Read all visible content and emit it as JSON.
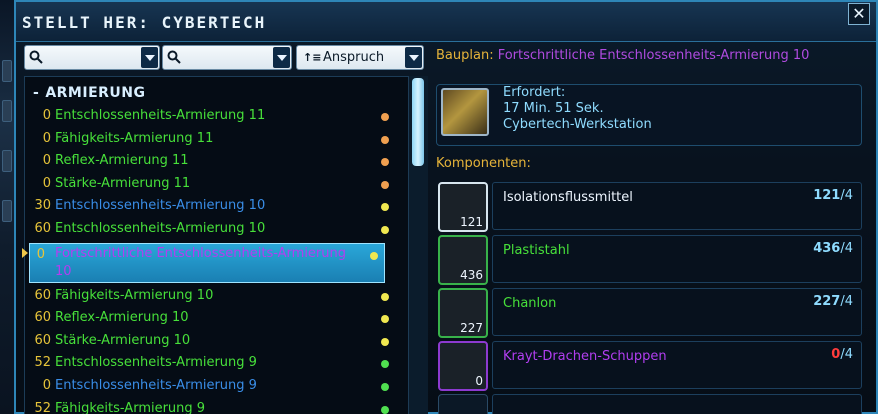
{
  "window": {
    "title": "STELLT HER: CYBERTECH",
    "close_label": "✕"
  },
  "filters": {
    "search1_placeholder": "",
    "search2_placeholder": "",
    "sort_label": "Anspruch",
    "sort_icon": "↑≡"
  },
  "list": {
    "category_label": "ARMIERUNG",
    "collapse_symbol": "-",
    "items": [
      {
        "level": "0",
        "name": "Entschlossenheits-Armierung 11",
        "name_color": "#47e03a",
        "dot_color": "#f0a050"
      },
      {
        "level": "0",
        "name": "Fähigkeits-Armierung 11",
        "name_color": "#47e03a",
        "dot_color": "#f0a050"
      },
      {
        "level": "0",
        "name": "Reflex-Armierung 11",
        "name_color": "#47e03a",
        "dot_color": "#f0a050"
      },
      {
        "level": "0",
        "name": "Stärke-Armierung 11",
        "name_color": "#47e03a",
        "dot_color": "#f0a050"
      },
      {
        "level": "30",
        "name": "Entschlossenheits-Armierung 10",
        "name_color": "#3a8ee8",
        "dot_color": "#f0e850"
      },
      {
        "level": "60",
        "name": "Entschlossenheits-Armierung 10",
        "name_color": "#47e03a",
        "dot_color": "#f0e850"
      },
      {
        "level": "0",
        "name": "Fortschrittliche Entschlossenheits-Armierung 10",
        "name_color": "#b23ef0",
        "dot_color": "#f0e850",
        "selected": true
      },
      {
        "level": "60",
        "name": "Fähigkeits-Armierung 10",
        "name_color": "#47e03a",
        "dot_color": "#f0e850"
      },
      {
        "level": "60",
        "name": "Reflex-Armierung 10",
        "name_color": "#47e03a",
        "dot_color": "#f0e850"
      },
      {
        "level": "60",
        "name": "Stärke-Armierung 10",
        "name_color": "#47e03a",
        "dot_color": "#f0e850"
      },
      {
        "level": "52",
        "name": "Entschlossenheits-Armierung 9",
        "name_color": "#47e03a",
        "dot_color": "#50e050"
      },
      {
        "level": "0",
        "name": "Entschlossenheits-Armierung 9",
        "name_color": "#3a8ee8",
        "dot_color": "#50e050"
      },
      {
        "level": "52",
        "name": "Fähigkeits-Armierung 9",
        "name_color": "#47e03a",
        "dot_color": "#50e050"
      }
    ]
  },
  "detail": {
    "bauplan_key": "Bauplan:",
    "bauplan_value": "Fortschrittliche Entschlossenheits-Armierung 10",
    "requires_label": "Erfordert:",
    "requires_time": "17 Min. 51 Sek.",
    "requires_station": "Cybertech-Werkstation",
    "components_label": "Komponenten:",
    "components": [
      {
        "name": "Isolationsflussmittel",
        "name_color": "#eef6ff",
        "have": "121",
        "need": "/4",
        "icon_qty": "121",
        "border": "white",
        "have_red": false,
        "icon_name": "isolationsflussmittel-icon"
      },
      {
        "name": "Plastistahl",
        "name_color": "#47e03a",
        "have": "436",
        "need": "/4",
        "icon_qty": "436",
        "border": "green",
        "have_red": false,
        "icon_name": "plastistahl-icon"
      },
      {
        "name": "Chanlon",
        "name_color": "#47e03a",
        "have": "227",
        "need": "/4",
        "icon_qty": "227",
        "border": "green",
        "have_red": false,
        "icon_name": "chanlon-icon"
      },
      {
        "name": "Krayt-Drachen-Schuppen",
        "name_color": "#b23ef0",
        "have": "0",
        "need": "/4",
        "icon_qty": "0",
        "border": "purple",
        "have_red": true,
        "icon_name": "krayt-drachen-schuppen-icon"
      }
    ]
  }
}
